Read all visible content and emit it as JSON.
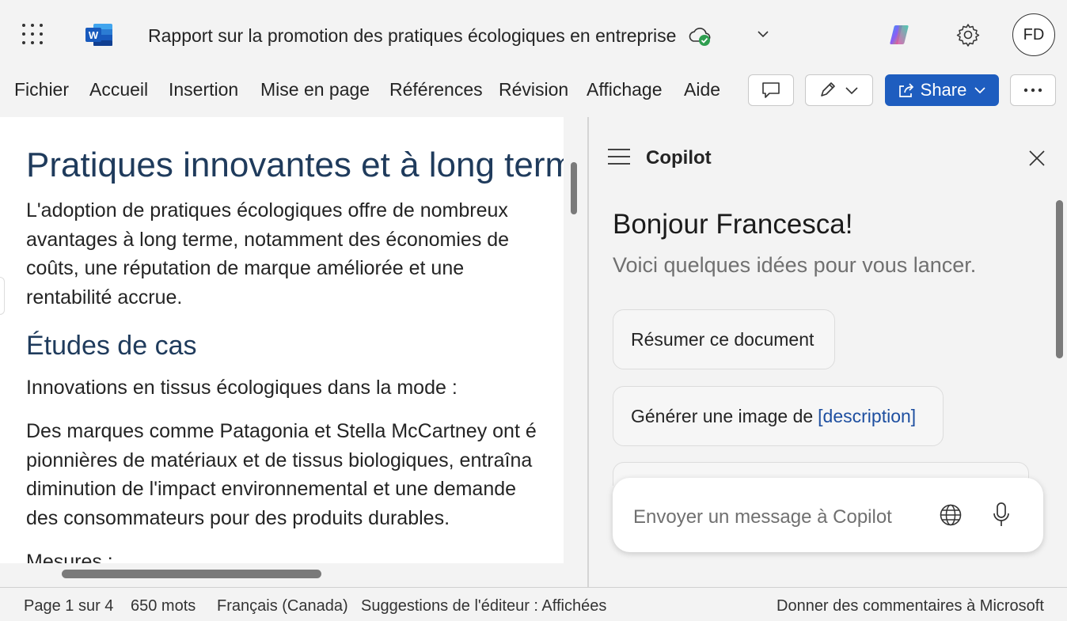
{
  "titlebar": {
    "app_icon": "word-icon",
    "app_letter": "W",
    "document_title": "Rapport sur la promotion des pratiques écologiques en entreprise",
    "save_status_icon": "cloud-check-icon",
    "user_initials": "FD"
  },
  "ribbon": {
    "menu": [
      "Fichier",
      "Accueil",
      "Insertion",
      "Mise en page",
      "Références",
      "Révision",
      "Affichage",
      "Aide"
    ],
    "share_label": "Share"
  },
  "document": {
    "heading1": "Pratiques innovantes et à long terme",
    "paragraph1": [
      "L'adoption de pratiques écologiques offre de nombreux",
      "avantages à long terme, notamment des économies de",
      "coûts, une réputation de marque améliorée et une",
      "rentabilité accrue."
    ],
    "heading2": "Études de cas",
    "paragraph2": "Innovations en tissus écologiques dans la mode :",
    "paragraph3": [
      "Des marques comme Patagonia et Stella McCartney ont é",
      "pionnières de matériaux et de tissus biologiques, entraîna",
      "diminution de l'impact environnemental et une demande",
      "des consommateurs pour des produits durables."
    ],
    "paragraph4": "Mesures :"
  },
  "copilot": {
    "title": "Copilot",
    "greeting": "Bonjour Francesca!",
    "subtitle": "Voici quelques idées pour vous lancer.",
    "suggestions": [
      {
        "text": "Résumer ce document",
        "placeholder": ""
      },
      {
        "text": "Générer une image de",
        "placeholder": "[description]"
      }
    ],
    "input_placeholder": "Envoyer un message à Copilot"
  },
  "statusbar": {
    "page": "Page 1 sur 4",
    "words": "650 mots",
    "language": "Français (Canada)",
    "editor": "Suggestions de l'éditeur : Affichées",
    "feedback": "Donner des commentaires à Microsoft"
  },
  "colors": {
    "accent": "#1e5dbf",
    "heading": "#1f3b5c",
    "word_blue": "#185abd",
    "sync_ok": "#2e9e4f"
  }
}
